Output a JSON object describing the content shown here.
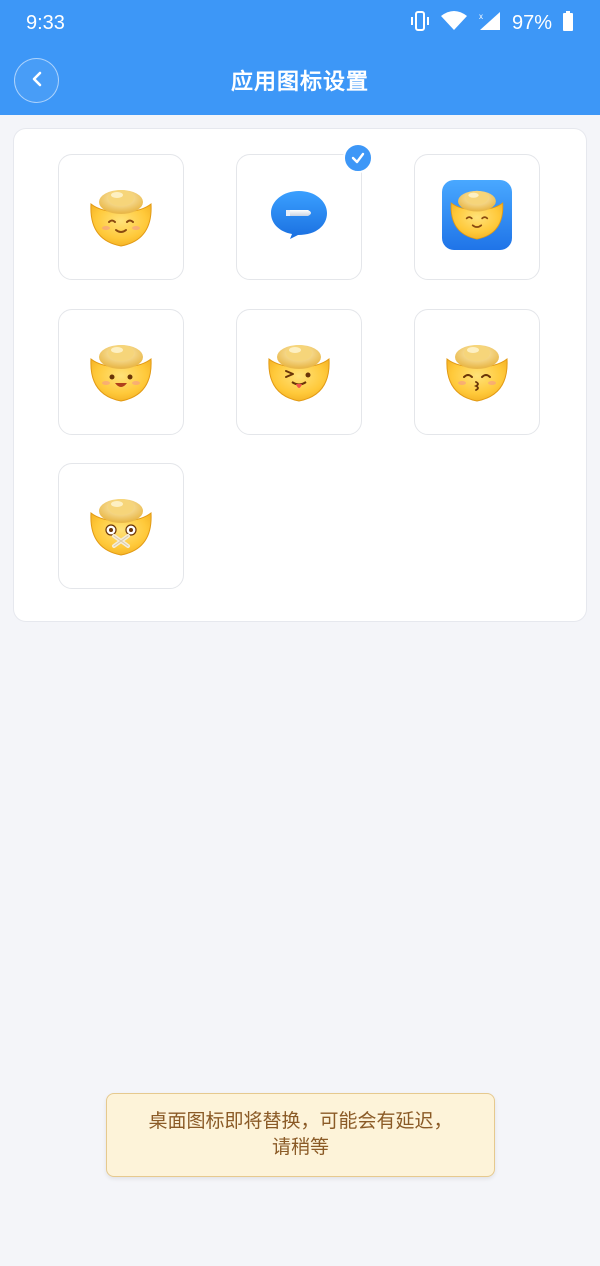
{
  "status_bar": {
    "time": "9:33",
    "battery_percent": "97%",
    "icons": [
      "vibrate-icon",
      "wifi-icon",
      "signal-icon",
      "battery-icon"
    ]
  },
  "header": {
    "title": "应用图标设置",
    "back_icon": "chevron-left-icon"
  },
  "icon_options": [
    {
      "name": "gold-ingot-smile",
      "selected": false
    },
    {
      "name": "message-bubble",
      "selected": true
    },
    {
      "name": "gold-ingot-blue-square",
      "selected": false
    },
    {
      "name": "gold-ingot-happy",
      "selected": false
    },
    {
      "name": "gold-ingot-wink-tongue",
      "selected": false
    },
    {
      "name": "gold-ingot-kiss",
      "selected": false
    },
    {
      "name": "gold-ingot-tape-mouth",
      "selected": false
    }
  ],
  "toast": {
    "message": "桌面图标即将替换，可能会有延迟，请稍等"
  },
  "colors": {
    "primary": "#3d97f7",
    "background": "#f4f5f9",
    "toast_bg": "#fdf3d9",
    "toast_text": "#8a5a26"
  }
}
